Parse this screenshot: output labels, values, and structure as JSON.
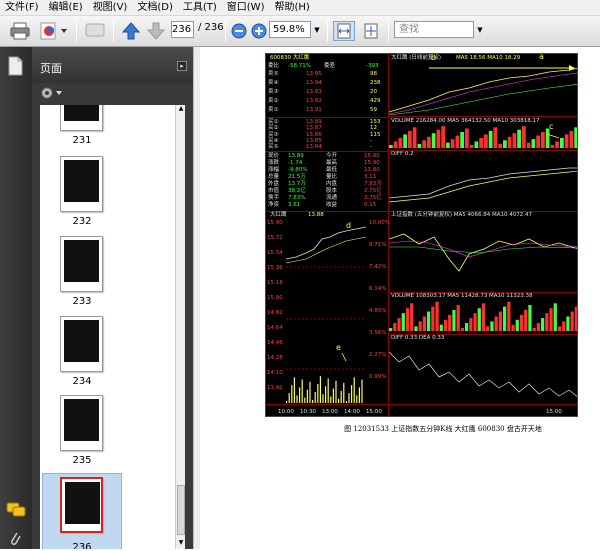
{
  "menu": [
    "文件(F)",
    "编辑(E)",
    "视图(V)",
    "文档(D)",
    "工具(T)",
    "窗口(W)",
    "帮助(H)"
  ],
  "toolbar": {
    "page_current": "236",
    "page_total": "/ 236",
    "zoom": "59.8%",
    "search_placeholder": "查找"
  },
  "sidebar": {
    "title": "页面",
    "thumbnails": [
      {
        "label": "231"
      },
      {
        "label": "232"
      },
      {
        "label": "233"
      },
      {
        "label": "234"
      },
      {
        "label": "235"
      },
      {
        "label": "236",
        "selected": true
      }
    ]
  },
  "document": {
    "caption": "图 12031533 上证指数五分钟K线  大红鹰 600830   盘古开天地"
  },
  "stock": {
    "code_name": "600830  大红鹰",
    "ratio_label": "委比",
    "ratio_value": "-58.71%",
    "diff_label": "委差",
    "diff_value": "-393",
    "sell_rows": [
      {
        "label": "卖⑤",
        "price": "13.95",
        "vol": "98"
      },
      {
        "label": "卖④",
        "price": "13.94",
        "vol": "238"
      },
      {
        "label": "卖③",
        "price": "13.93",
        "vol": "20"
      },
      {
        "label": "卖②",
        "price": "13.92",
        "vol": "429"
      },
      {
        "label": "卖①",
        "price": "13.91",
        "vol": "59"
      }
    ],
    "buy_rows": [
      {
        "label": "买①",
        "price": "13.89",
        "vol": "153"
      },
      {
        "label": "买②",
        "price": "13.87",
        "vol": "12"
      },
      {
        "label": "买③",
        "price": "13.86",
        "vol": "115"
      },
      {
        "label": "买④",
        "price": "13.85",
        "vol": "-"
      },
      {
        "label": "买⑤",
        "price": "13.84",
        "vol": "-"
      }
    ],
    "top_chart_label": "大红鹰  (日线前复权)",
    "ma_label": "MA5 18.56  MA10 18.29",
    "annotation_b": "b",
    "annotation_a": "a",
    "annotation_c": "c",
    "annotation_d": "d",
    "annotation_e": "e",
    "volume_label": "VOLUME 216284.00  MA5 364132.50  MA10 303818.17",
    "volume_label_2": "VOLUME 108303.17  MA5 11428.73  MA10 11323.38",
    "macd_label": "DIFF 0.2",
    "macd_label_2": "DIFF 0.33  DEA 0.33",
    "intraday_label": "大红鹰",
    "intraday_value": "13.88",
    "mid_chart_label": "上证指数 (五分钟前复权)  MA5 4066.84  MA10 4072.47",
    "info_rows": [
      {
        "label": "现价",
        "value": "13.89",
        "label2": "今开",
        "value2": "15.90"
      },
      {
        "label": "涨跌",
        "value": "-1.74",
        "label2": "最高",
        "value2": "15.90"
      },
      {
        "label": "涨幅",
        "value": "-9.80%",
        "label2": "最低",
        "value2": "13.80"
      },
      {
        "label": "总量",
        "value": "21.5万",
        "label2": "量比",
        "value2": "3.11"
      },
      {
        "label": "外盘",
        "value": "13.7万",
        "label2": "内盘",
        "value2": "7.83万"
      },
      {
        "label": "市值",
        "value": "38.2亿",
        "label2": "股本",
        "value2": "2.75亿"
      },
      {
        "label": "换手",
        "value": "7.83%",
        "label2": "流通",
        "value2": "2.75亿"
      },
      {
        "label": "净资",
        "value": "3.61",
        "label2": "收益",
        "value2": "0.15"
      }
    ],
    "price_ticks": [
      "15.90",
      "15.72",
      "15.54",
      "15.36",
      "15.18",
      "15.00",
      "14.82",
      "14.64",
      "14.46",
      "14.28",
      "14.10",
      "13.92"
    ],
    "pct_ticks": [
      "10.00%",
      "8.71%",
      "7.42%",
      "6.14%",
      "4.85%",
      "3.56%",
      "2.27%",
      "0.99%"
    ],
    "bottom_ticks": [
      "10:00",
      "10:30",
      "13:00",
      "14:00",
      "15:00"
    ],
    "time_label": "15:00"
  }
}
